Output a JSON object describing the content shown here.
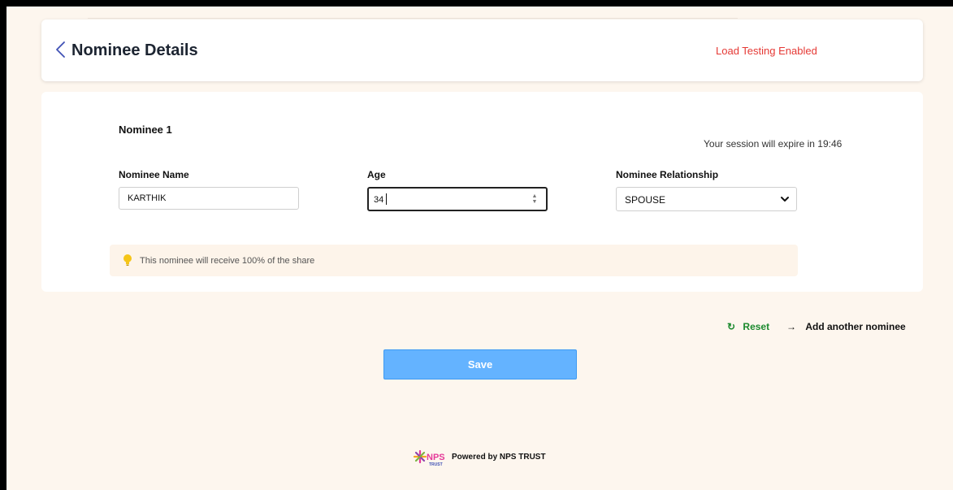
{
  "header": {
    "title": "Nominee Details",
    "load_testing": "Load Testing Enabled",
    "back_icon": "chevron-left-icon"
  },
  "form": {
    "nominee_heading": "Nominee 1",
    "session_expiry": "Your session will expire in 19:46",
    "fields": {
      "name_label": "Nominee Name",
      "name_value": "KARTHIK",
      "age_label": "Age",
      "age_value": "34",
      "relationship_label": "Nominee Relationship",
      "relationship_value": "SPOUSE"
    },
    "info_text": "This nominee will receive 100% of the share"
  },
  "actions": {
    "reset_label": "Reset",
    "reset_icon": "↻",
    "add_label": "Add another nominee",
    "add_icon": "→",
    "save_label": "Save"
  },
  "footer": {
    "logo_text": "NPS",
    "logo_subtext": "TRUST",
    "powered_by": "Powered by NPS TRUST"
  },
  "colors": {
    "background": "#fdf6ee",
    "load_testing": "#e53935",
    "reset": "#1b8a2e",
    "save_button": "#64b3ff",
    "back_icon": "#3f51b5"
  }
}
